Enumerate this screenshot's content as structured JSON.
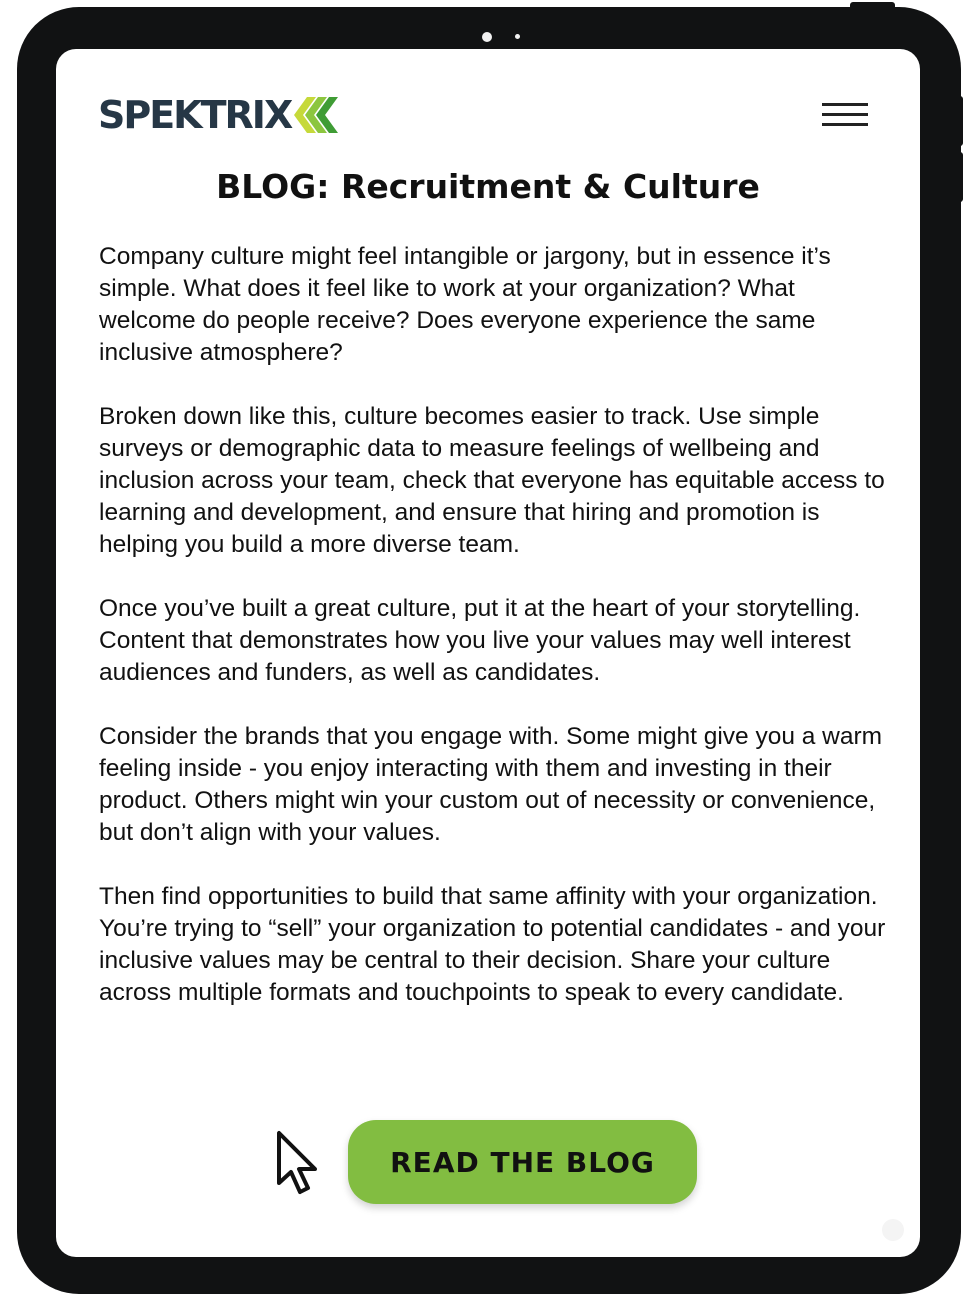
{
  "header": {
    "brand": "SPEKTRIX",
    "logo_icon": "triple-chevron-left-icon",
    "menu_icon": "hamburger-menu-icon"
  },
  "page_title": "BLOG: Recruitment & Culture",
  "article": {
    "paragraphs": [
      "Company culture might feel intangible or jargony, but in essence it’s simple. What does it feel like to work at your organization? What welcome do people receive? Does everyone experience the same inclusive atmosphere?",
      "Broken down like this, culture becomes easier to track. Use simple surveys or demographic data to measure feelings of wellbeing and inclusion across your team, check that everyone has equitable access to learning and development, and ensure that hiring and promotion is helping you build a more diverse team.",
      "Once you’ve built a great culture, put it at the heart of your storytelling. Content that demonstrates how you live your values may well interest audiences and funders, as well as candidates.",
      "Consider the brands that you engage with. Some might give you a warm feeling inside - you enjoy interacting with them and investing in their product. Others might win your custom out of necessity or convenience, but don’t align with your values.",
      "Then find opportunities to build that same affinity with your organization. You’re trying to “sell” your organization to potential candidates - and your inclusive values may be central to their decision. Share your culture across multiple formats and touchpoints to speak to every candidate."
    ]
  },
  "cta": {
    "label": "READ THE BLOG",
    "cursor_icon": "mouse-pointer-icon"
  },
  "colors": {
    "brand_dark": "#263746",
    "brand_green": "#82bd41",
    "chevron_light": "#c6d93a",
    "chevron_mid": "#8cc63f",
    "chevron_dark": "#3f9c35",
    "device_frame": "#111213"
  }
}
